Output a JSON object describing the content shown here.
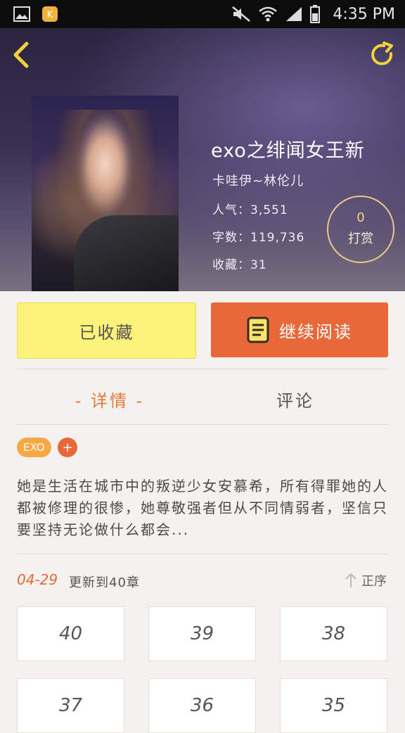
{
  "status_bar": {
    "time": "4:35 PM",
    "left_icons": [
      "gallery-icon",
      "app-notification-icon"
    ],
    "right_icons": [
      "mute-icon",
      "wifi-icon",
      "signal-icon",
      "battery-icon"
    ]
  },
  "header": {
    "back_icon": "chevron-left-icon",
    "refresh_icon": "refresh-icon",
    "book_title": "exo之绯闻女王新",
    "author": "卡哇伊~林伦儿",
    "popularity_label": "人气：",
    "popularity_value": "3,551",
    "word_count_label": "字数：",
    "word_count_value": "119,736",
    "favorites_label": "收藏：",
    "favorites_value": "31",
    "tip": {
      "count": "0",
      "label": "打赏"
    }
  },
  "actions": {
    "collected_label": "已收藏",
    "read_label": "继续阅读",
    "read_icon": "book-icon"
  },
  "tabs": {
    "detail": "- 详情 -",
    "comment": "评论"
  },
  "tags": {
    "items": [
      "EXO"
    ],
    "add": "+"
  },
  "summary": "她是生活在城市中的叛逆少女安慕希，所有得罪她的人都被修理的很惨，她尊敬强者但从不同情弱者，坚信只要坚持无论做什么都会...",
  "update": {
    "date": "04-29",
    "text": "更新到40章",
    "sort_label": "正序"
  },
  "chapters": [
    "40",
    "39",
    "38",
    "37",
    "36",
    "35"
  ],
  "colors": {
    "accent_orange": "#e8683a",
    "tag_orange": "#f5a844",
    "collected_yellow": "#fdf27a"
  }
}
